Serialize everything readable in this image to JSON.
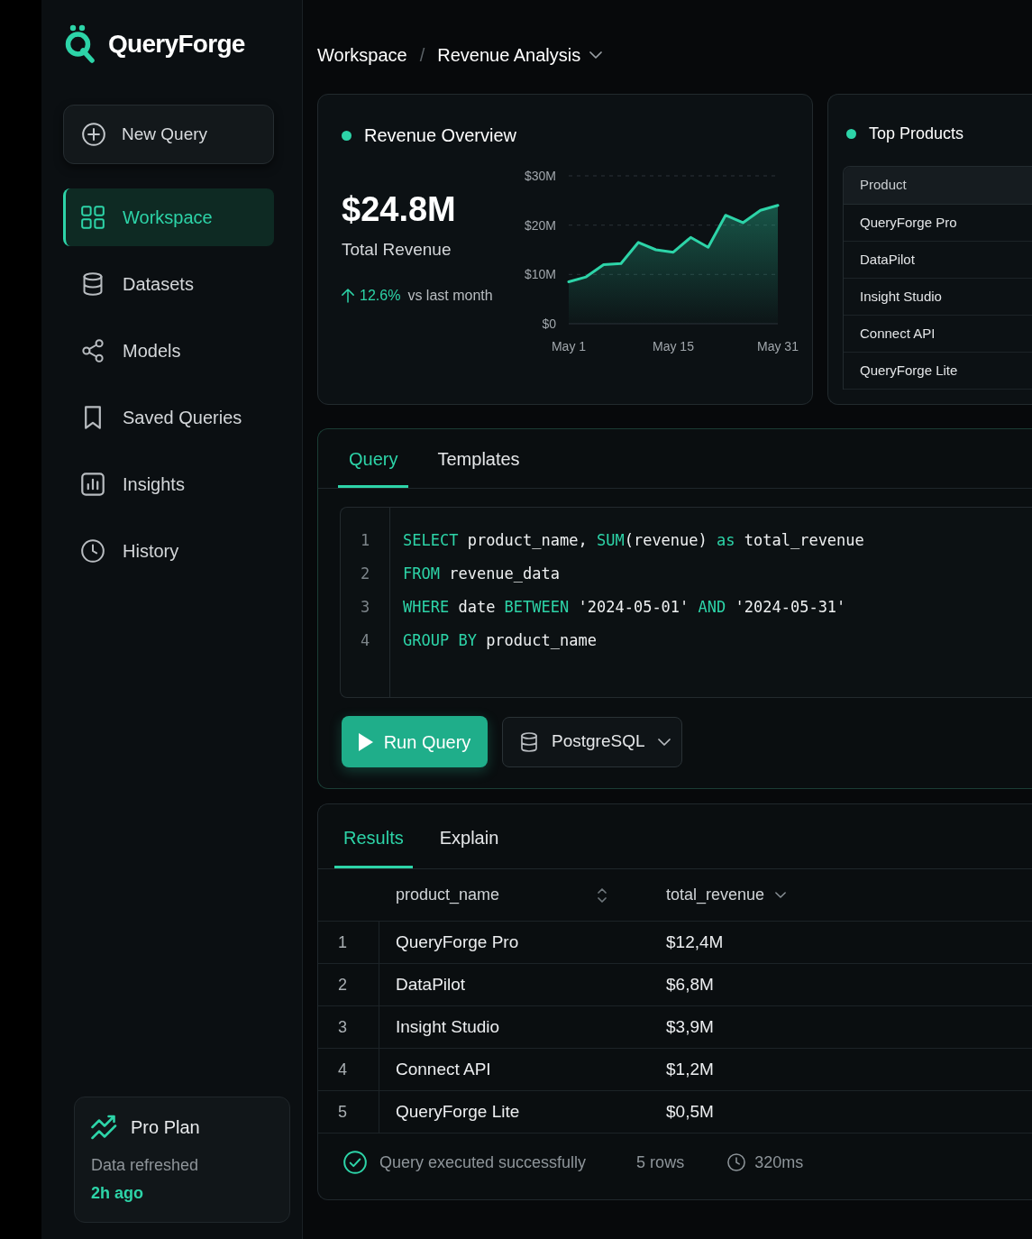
{
  "app": {
    "name": "QueryForge"
  },
  "sidebar": {
    "new_query_button": "New Query",
    "items": [
      {
        "label": "Workspace",
        "selected": true
      },
      {
        "label": "Datasets",
        "selected": false
      },
      {
        "label": "Models",
        "selected": false
      },
      {
        "label": "Saved Queries",
        "selected": false
      },
      {
        "label": "Insights",
        "selected": false
      },
      {
        "label": "History",
        "selected": false
      }
    ],
    "plan_card": {
      "title": "Pro Plan",
      "note": "Data refreshed",
      "time": "2h ago"
    }
  },
  "breadcrumb": {
    "items": [
      "Workspace",
      "Revenue Analysis"
    ],
    "separator": "/"
  },
  "revenue_overview": {
    "title": "Revenue Overview",
    "value": "$24.8M",
    "label": "Total Revenue",
    "change": "12.6%",
    "change_note": "vs last month",
    "chart_data": {
      "type": "area",
      "categories": [
        "May 1",
        null,
        null,
        null,
        null,
        null,
        "May 15",
        null,
        null,
        null,
        null,
        null,
        "May 31"
      ],
      "series": [
        {
          "color": "#2dd4a8",
          "values": [
            8.5,
            9.5,
            12,
            12.2,
            16.5,
            15,
            14.5,
            17.5,
            15.5,
            22,
            20.5,
            23,
            24
          ]
        }
      ],
      "ylim": [
        0,
        30
      ],
      "yticks": [
        {
          "value": 0,
          "label": "$0"
        },
        {
          "value": 10,
          "label": "$10M"
        },
        {
          "value": 20,
          "label": "$20M"
        },
        {
          "value": 30,
          "label": "$30M"
        }
      ]
    }
  },
  "top_products": {
    "title": "Top Products",
    "header": "Product",
    "items": [
      "QueryForge Pro",
      "DataPilot",
      "Insight Studio",
      "Connect API",
      "QueryForge Lite"
    ]
  },
  "query_panel": {
    "tabs": [
      {
        "label": "Query",
        "selected": true
      },
      {
        "label": "Templates",
        "selected": false
      }
    ],
    "code_lines": [
      {
        "number": "1",
        "tokens": [
          {
            "kind": "keyword",
            "text": "SELECT"
          },
          {
            "kind": "plain",
            "text": " product_name, "
          },
          {
            "kind": "keyword",
            "text": "SUM"
          },
          {
            "kind": "plain",
            "text": "(revenue) "
          },
          {
            "kind": "keyword",
            "text": "as"
          },
          {
            "kind": "plain",
            "text": " total_revenue"
          }
        ]
      },
      {
        "number": "2",
        "tokens": [
          {
            "kind": "keyword",
            "text": "FROM"
          },
          {
            "kind": "plain",
            "text": " revenue_data"
          }
        ]
      },
      {
        "number": "3",
        "tokens": [
          {
            "kind": "keyword",
            "text": "WHERE"
          },
          {
            "kind": "plain",
            "text": " date "
          },
          {
            "kind": "keyword",
            "text": "BETWEEN"
          },
          {
            "kind": "plain",
            "text": " '2024-05-01' "
          },
          {
            "kind": "keyword",
            "text": "AND"
          },
          {
            "kind": "plain",
            "text": " '2024-05-31'"
          }
        ]
      },
      {
        "number": "4",
        "tokens": [
          {
            "kind": "keyword",
            "text": "GROUP BY"
          },
          {
            "kind": "plain",
            "text": " product_name"
          }
        ]
      }
    ],
    "run_button": "Run Query",
    "dialect": "PostgreSQL"
  },
  "results": {
    "tabs": [
      {
        "label": "Results",
        "selected": true
      },
      {
        "label": "Explain",
        "selected": false
      }
    ],
    "columns": [
      {
        "label": "product_name",
        "sorted": false
      },
      {
        "label": "total_revenue",
        "sorted": true
      }
    ],
    "rows": [
      {
        "number": "1",
        "cells": [
          "QueryForge Pro",
          "$12,4M"
        ]
      },
      {
        "number": "2",
        "cells": [
          "DataPilot",
          "$6,8M"
        ]
      },
      {
        "number": "3",
        "cells": [
          "Insight Studio",
          "$3,9M"
        ]
      },
      {
        "number": "4",
        "cells": [
          "Connect API",
          "$1,2M"
        ]
      },
      {
        "number": "5",
        "cells": [
          "QueryForge Lite",
          "$0,5M"
        ]
      }
    ],
    "status": {
      "message": "Query executed successfully",
      "row_count": "5 rows",
      "duration": "320ms"
    }
  }
}
